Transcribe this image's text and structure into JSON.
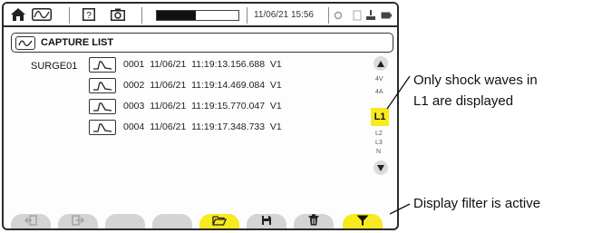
{
  "topbar": {
    "datetime": "11/06/21 15:56",
    "progress_fraction": 0.48,
    "icons": [
      "home-icon",
      "waveform-icon",
      "help-icon",
      "camera-icon",
      "settings-icon",
      "memory-icon",
      "network-icon",
      "battery-icon"
    ]
  },
  "title": {
    "label": "CAPTURE LIST",
    "icon": "waveform-icon"
  },
  "list": {
    "name": "SURGE01",
    "rows": [
      {
        "text": "0001  11/06/21  11:19:13.156.688  V1"
      },
      {
        "text": "0002  11/06/21  11:19:14.469.084  V1"
      },
      {
        "text": "0003  11/06/21  11:19:15.770.047  V1"
      },
      {
        "text": "0004  11/06/21  11:19:17.348.733  V1"
      }
    ]
  },
  "filter": {
    "items_above": [
      "4V",
      "4A"
    ],
    "active": "L1",
    "items_below": [
      "L2",
      "L3",
      "N"
    ],
    "accent": "#f7ea1e"
  },
  "function_bar": {
    "buttons": [
      {
        "icon": "exit-icon",
        "active": false
      },
      {
        "icon": "enter-icon",
        "active": false
      },
      {
        "icon": "blank",
        "active": false
      },
      {
        "icon": "blank",
        "active": false
      },
      {
        "icon": "folder-open-icon",
        "active": true
      },
      {
        "icon": "save-icon",
        "active": false
      },
      {
        "icon": "trash-icon",
        "active": false
      },
      {
        "icon": "filter-icon",
        "active": true
      }
    ]
  },
  "annotations": {
    "filter_note_line1": "Only shock waves in",
    "filter_note_line2": "L1 are displayed",
    "active_note": "Display filter is active"
  }
}
